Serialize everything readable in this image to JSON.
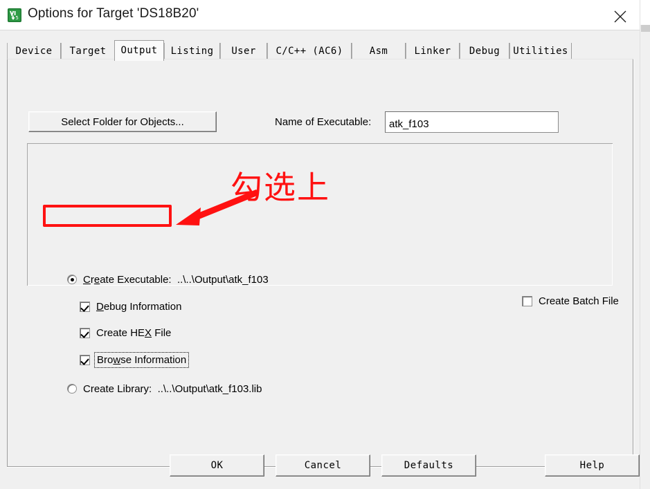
{
  "window": {
    "title": "Options for Target 'DS18B20'",
    "icon": "keil-uvision-icon",
    "close_icon": "close-icon"
  },
  "tabs": [
    {
      "label": "Device",
      "active": false
    },
    {
      "label": "Target",
      "active": false
    },
    {
      "label": "Output",
      "active": true
    },
    {
      "label": "Listing",
      "active": false
    },
    {
      "label": "User",
      "active": false
    },
    {
      "label": "C/C++ (AC6)",
      "active": false
    },
    {
      "label": "Asm",
      "active": false
    },
    {
      "label": "Linker",
      "active": false
    },
    {
      "label": "Debug",
      "active": false
    },
    {
      "label": "Utilities",
      "active": false
    }
  ],
  "output_page": {
    "select_folder_button": "Select Folder for Objects...",
    "executable_name_label": "Name of Executable:",
    "executable_name_value": "atk_f103",
    "executable_name_placeholder": "",
    "create_executable": {
      "label": "Create Executable:",
      "path": "..\\..\\Output\\atk_f103",
      "selected": true
    },
    "debug_information": {
      "label": "Debug Information",
      "checked": true
    },
    "create_hex_file": {
      "label": "Create HEX File",
      "checked": true
    },
    "browse_information": {
      "label": "Browse Information",
      "checked": true,
      "focused": true
    },
    "create_library": {
      "label": "Create Library:",
      "path": "..\\..\\Output\\atk_f103.lib",
      "selected": false
    },
    "create_batch_file": {
      "label": "Create Batch File",
      "checked": false
    }
  },
  "annotation": {
    "text": "勾选上",
    "color": "#ff1111",
    "arrow": "red-arrow-annotation",
    "highlight_box": "red-rectangle-highlight"
  },
  "footer_buttons": [
    {
      "label": "OK"
    },
    {
      "label": "Cancel"
    },
    {
      "label": "Defaults"
    },
    {
      "label": "Help"
    }
  ]
}
